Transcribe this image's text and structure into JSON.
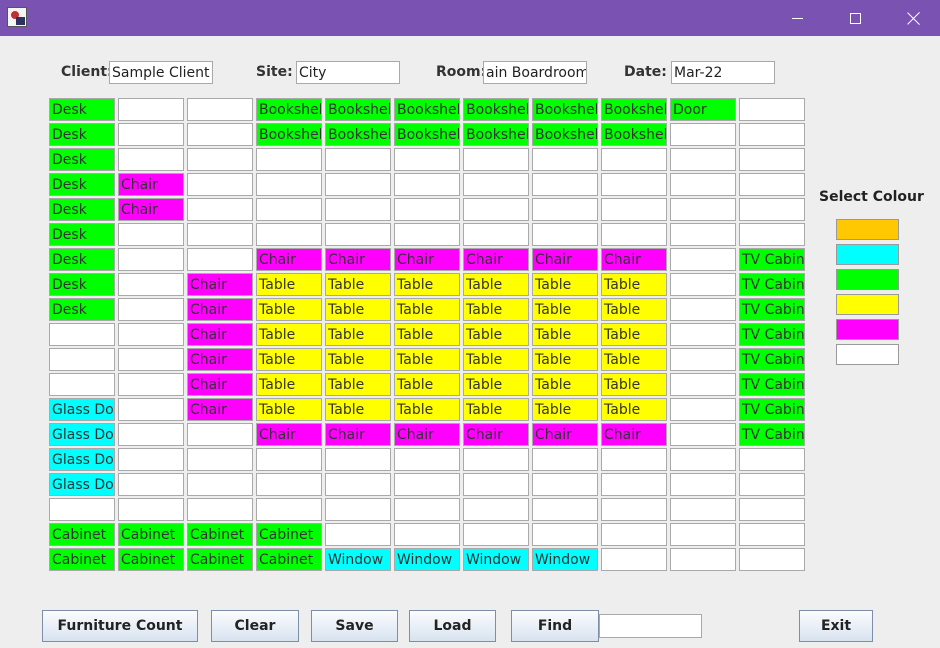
{
  "header": {
    "client_label": "Client:",
    "client_value": "Sample Client",
    "site_label": "Site:",
    "site_value": "City",
    "room_label": "Room:",
    "room_value": "ain Boardroom",
    "date_label": "Date:",
    "date_value": "Mar-22"
  },
  "colours": {
    "orange": "#ffc800",
    "cyan": "#00ffff",
    "green": "#00ff00",
    "yellow": "#ffff00",
    "magenta": "#ff00ff",
    "white": "#ffffff"
  },
  "legend": {
    "title": "Select Colour",
    "swatches": [
      "orange",
      "cyan",
      "green",
      "yellow",
      "magenta",
      "white"
    ]
  },
  "grid": {
    "rows": [
      [
        [
          "Desk",
          "green"
        ],
        null,
        null,
        [
          "Bookshelf",
          "green"
        ],
        [
          "Bookshelf",
          "green"
        ],
        [
          "Bookshelf",
          "green"
        ],
        [
          "Bookshelf",
          "green"
        ],
        [
          "Bookshelf",
          "green"
        ],
        [
          "Bookshelf",
          "green"
        ],
        [
          "Door",
          "green"
        ],
        null
      ],
      [
        [
          "Desk",
          "green"
        ],
        null,
        null,
        [
          "Bookshelf",
          "green"
        ],
        [
          "Bookshelf",
          "green"
        ],
        [
          "Bookshelf",
          "green"
        ],
        [
          "Bookshelf",
          "green"
        ],
        [
          "Bookshelf",
          "green"
        ],
        [
          "Bookshelf",
          "green"
        ],
        null,
        null
      ],
      [
        [
          "Desk",
          "green"
        ],
        null,
        null,
        null,
        null,
        null,
        null,
        null,
        null,
        null,
        null
      ],
      [
        [
          "Desk",
          "green"
        ],
        [
          "Chair",
          "magenta"
        ],
        null,
        null,
        null,
        null,
        null,
        null,
        null,
        null,
        null
      ],
      [
        [
          "Desk",
          "green"
        ],
        [
          "Chair",
          "magenta"
        ],
        null,
        null,
        null,
        null,
        null,
        null,
        null,
        null,
        null
      ],
      [
        [
          "Desk",
          "green"
        ],
        null,
        null,
        null,
        null,
        null,
        null,
        null,
        null,
        null,
        null
      ],
      [
        [
          "Desk",
          "green"
        ],
        null,
        null,
        [
          "Chair",
          "magenta"
        ],
        [
          "Chair",
          "magenta"
        ],
        [
          "Chair",
          "magenta"
        ],
        [
          "Chair",
          "magenta"
        ],
        [
          "Chair",
          "magenta"
        ],
        [
          "Chair",
          "magenta"
        ],
        null,
        [
          "TV Cabinet",
          "green"
        ]
      ],
      [
        [
          "Desk",
          "green"
        ],
        null,
        [
          "Chair",
          "magenta"
        ],
        [
          "Table",
          "yellow"
        ],
        [
          "Table",
          "yellow"
        ],
        [
          "Table",
          "yellow"
        ],
        [
          "Table",
          "yellow"
        ],
        [
          "Table",
          "yellow"
        ],
        [
          "Table",
          "yellow"
        ],
        null,
        [
          "TV Cabinet",
          "green"
        ]
      ],
      [
        [
          "Desk",
          "green"
        ],
        null,
        [
          "Chair",
          "magenta"
        ],
        [
          "Table",
          "yellow"
        ],
        [
          "Table",
          "yellow"
        ],
        [
          "Table",
          "yellow"
        ],
        [
          "Table",
          "yellow"
        ],
        [
          "Table",
          "yellow"
        ],
        [
          "Table",
          "yellow"
        ],
        null,
        [
          "TV Cabinet",
          "green"
        ]
      ],
      [
        null,
        null,
        [
          "Chair",
          "magenta"
        ],
        [
          "Table",
          "yellow"
        ],
        [
          "Table",
          "yellow"
        ],
        [
          "Table",
          "yellow"
        ],
        [
          "Table",
          "yellow"
        ],
        [
          "Table",
          "yellow"
        ],
        [
          "Table",
          "yellow"
        ],
        null,
        [
          "TV Cabinet",
          "green"
        ]
      ],
      [
        null,
        null,
        [
          "Chair",
          "magenta"
        ],
        [
          "Table",
          "yellow"
        ],
        [
          "Table",
          "yellow"
        ],
        [
          "Table",
          "yellow"
        ],
        [
          "Table",
          "yellow"
        ],
        [
          "Table",
          "yellow"
        ],
        [
          "Table",
          "yellow"
        ],
        null,
        [
          "TV Cabinet",
          "green"
        ]
      ],
      [
        null,
        null,
        [
          "Chair",
          "magenta"
        ],
        [
          "Table",
          "yellow"
        ],
        [
          "Table",
          "yellow"
        ],
        [
          "Table",
          "yellow"
        ],
        [
          "Table",
          "yellow"
        ],
        [
          "Table",
          "yellow"
        ],
        [
          "Table",
          "yellow"
        ],
        null,
        [
          "TV Cabinet",
          "green"
        ]
      ],
      [
        [
          "Glass Door",
          "cyan"
        ],
        null,
        [
          "Chair",
          "magenta"
        ],
        [
          "Table",
          "yellow"
        ],
        [
          "Table",
          "yellow"
        ],
        [
          "Table",
          "yellow"
        ],
        [
          "Table",
          "yellow"
        ],
        [
          "Table",
          "yellow"
        ],
        [
          "Table",
          "yellow"
        ],
        null,
        [
          "TV Cabinet",
          "green"
        ]
      ],
      [
        [
          "Glass Door",
          "cyan"
        ],
        null,
        null,
        [
          "Chair",
          "magenta"
        ],
        [
          "Chair",
          "magenta"
        ],
        [
          "Chair",
          "magenta"
        ],
        [
          "Chair",
          "magenta"
        ],
        [
          "Chair",
          "magenta"
        ],
        [
          "Chair",
          "magenta"
        ],
        null,
        [
          "TV Cabinet",
          "green"
        ]
      ],
      [
        [
          "Glass Door",
          "cyan"
        ],
        null,
        null,
        null,
        null,
        null,
        null,
        null,
        null,
        null,
        null
      ],
      [
        [
          "Glass Door",
          "cyan"
        ],
        null,
        null,
        null,
        null,
        null,
        null,
        null,
        null,
        null,
        null
      ],
      [
        null,
        null,
        null,
        null,
        null,
        null,
        null,
        null,
        null,
        null,
        null
      ],
      [
        [
          "Cabinet",
          "green"
        ],
        [
          "Cabinet",
          "green"
        ],
        [
          "Cabinet",
          "green"
        ],
        [
          "Cabinet",
          "green"
        ],
        null,
        null,
        null,
        null,
        null,
        null,
        null
      ],
      [
        [
          "Cabinet",
          "green"
        ],
        [
          "Cabinet",
          "green"
        ],
        [
          "Cabinet",
          "green"
        ],
        [
          "Cabinet",
          "green"
        ],
        [
          "Window",
          "cyan"
        ],
        [
          "Window",
          "cyan"
        ],
        [
          "Window",
          "cyan"
        ],
        [
          "Window",
          "cyan"
        ],
        null,
        null,
        null
      ]
    ]
  },
  "buttons": {
    "furniture_count": "Furniture Count",
    "clear": "Clear",
    "save": "Save",
    "load": "Load",
    "find": "Find",
    "exit": "Exit"
  },
  "find_value": ""
}
